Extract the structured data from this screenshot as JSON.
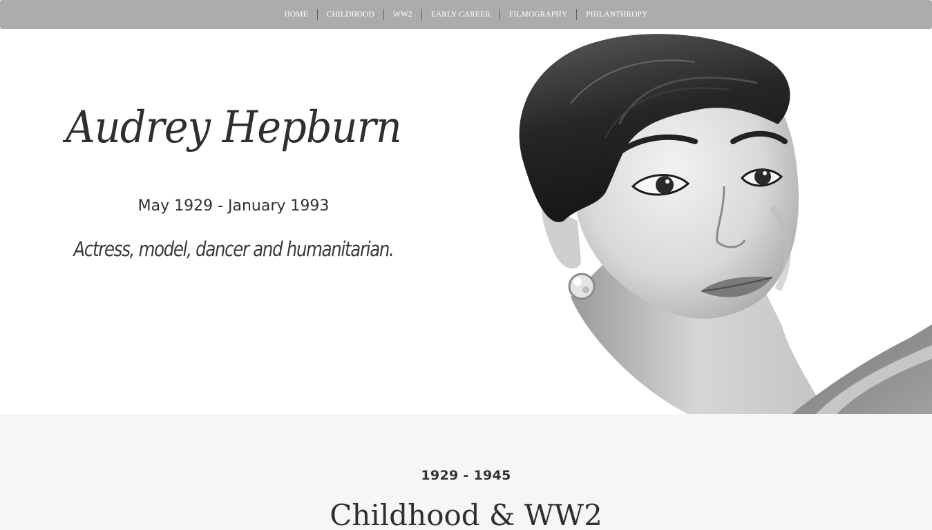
{
  "nav": {
    "items": [
      {
        "label": "HOME"
      },
      {
        "label": "CHILDHOOD"
      },
      {
        "label": "WW2"
      },
      {
        "label": "EARLY CAREER"
      },
      {
        "label": "FILMOGRAPHY"
      },
      {
        "label": "PHILANTHROPY"
      }
    ]
  },
  "hero": {
    "name": "Audrey Hepburn",
    "dates": "May 1929 - January 1993",
    "tagline": "Actress, model, dancer and humanitarian.",
    "image_style": "black-and-white portrait photograph"
  },
  "section": {
    "years": "1929 - 1945",
    "title": "Childhood & WW2"
  },
  "colors": {
    "nav_background": "#acacac",
    "nav_text": "#ffffff",
    "section_background": "#f6f6f6",
    "text_dark": "#2f2f2f"
  }
}
